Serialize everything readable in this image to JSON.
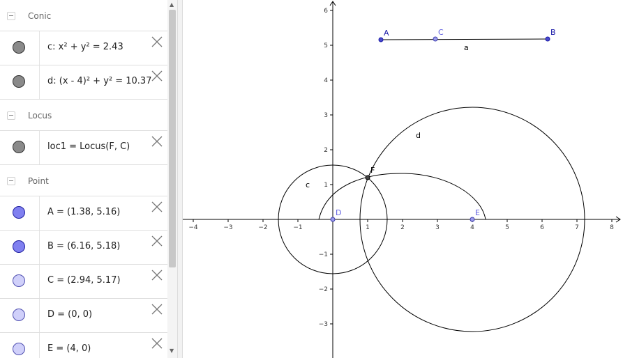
{
  "algebra": {
    "categories": [
      {
        "label": "Conic",
        "items": [
          {
            "formula": "c: x² + y² = 2.43",
            "marble": "dark"
          },
          {
            "formula": "d: (x - 4)² + y² = 10.37",
            "marble": "dark"
          }
        ]
      },
      {
        "label": "Locus",
        "items": [
          {
            "formula": "loc1 = Locus(F, C)",
            "marble": "dark"
          }
        ]
      },
      {
        "label": "Point",
        "items": [
          {
            "formula": "A = (1.38, 5.16)",
            "marble": "blue"
          },
          {
            "formula": "B = (6.16, 5.18)",
            "marble": "blue"
          },
          {
            "formula": "C = (2.94, 5.17)",
            "marble": "light"
          },
          {
            "formula": "D = (0, 0)",
            "marble": "light"
          },
          {
            "formula": "E = (4, 0)",
            "marble": "light"
          }
        ]
      }
    ]
  },
  "graphics": {
    "x_ticks": [
      "−4",
      "−3",
      "−2",
      "−1",
      "1",
      "2",
      "3",
      "4",
      "5",
      "6",
      "7",
      "8"
    ],
    "y_ticks": [
      "6",
      "5",
      "4",
      "3",
      "2",
      "1",
      "−1",
      "−2",
      "−3"
    ],
    "labels": {
      "A": "A",
      "B": "B",
      "C": "C",
      "D": "D",
      "E": "E",
      "F": "F",
      "a": "a",
      "c": "c",
      "d": "d"
    },
    "colors": {
      "free_point": "#1a1aa8",
      "dependent_point": "#6060e0",
      "curve": "#000000",
      "axis": "#000000"
    }
  }
}
